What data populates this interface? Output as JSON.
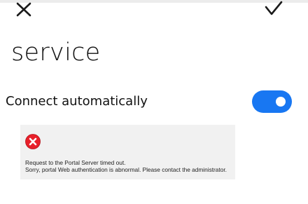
{
  "header": {
    "close_icon": "close-icon",
    "confirm_icon": "checkmark-icon"
  },
  "page": {
    "title": "service"
  },
  "settings": {
    "auto_connect": {
      "label": "Connect automatically",
      "enabled": true,
      "accent_color": "#1877f2"
    }
  },
  "error_message": {
    "icon": "error-x-icon",
    "icon_color": "#e8202a",
    "lines": [
      "Request to the Portal Server timed out.",
      "Sorry, portal Web authentication is abnormal. Please contact the administrator."
    ]
  }
}
